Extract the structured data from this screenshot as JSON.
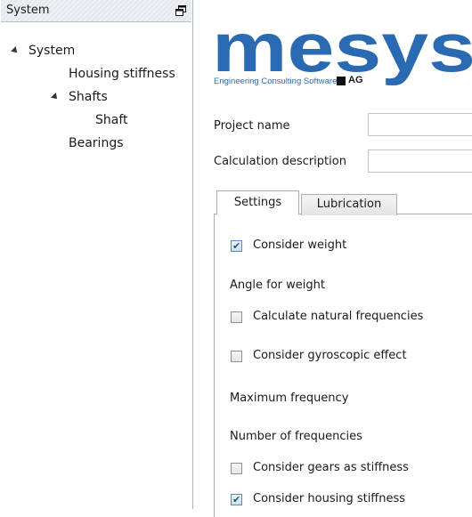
{
  "dock": {
    "title": "System",
    "float_icon": "float-window-icon"
  },
  "tree": {
    "items": [
      {
        "label": "System",
        "expanded": true
      },
      {
        "label": "Housing stiffness"
      },
      {
        "label": "Shafts",
        "expanded": true
      },
      {
        "label": "Shaft"
      },
      {
        "label": "Bearings"
      }
    ]
  },
  "logo": {
    "brand": "mesys",
    "tagline": "Engineering Consulting Software",
    "suffix": "AG",
    "color": "#2a6ab3"
  },
  "form": {
    "project_name_label": "Project name",
    "project_name_value": "",
    "calc_desc_label": "Calculation description",
    "calc_desc_value": ""
  },
  "tabs": {
    "active": "Settings",
    "inactive": "Lubrication"
  },
  "settings": {
    "consider_weight": {
      "label": "Consider weight",
      "checked": true
    },
    "angle_for_weight": "Angle for weight",
    "calc_natural_freq": {
      "label": "Calculate natural frequencies",
      "checked": false
    },
    "gyroscopic": {
      "label": "Consider gyroscopic effect",
      "checked": false
    },
    "max_frequency": "Maximum frequency",
    "num_frequencies": "Number of frequencies",
    "gears_stiffness": {
      "label": "Consider gears as stiffness",
      "checked": false
    },
    "housing_stiffness": {
      "label": "Consider housing stiffness",
      "checked": true
    }
  }
}
